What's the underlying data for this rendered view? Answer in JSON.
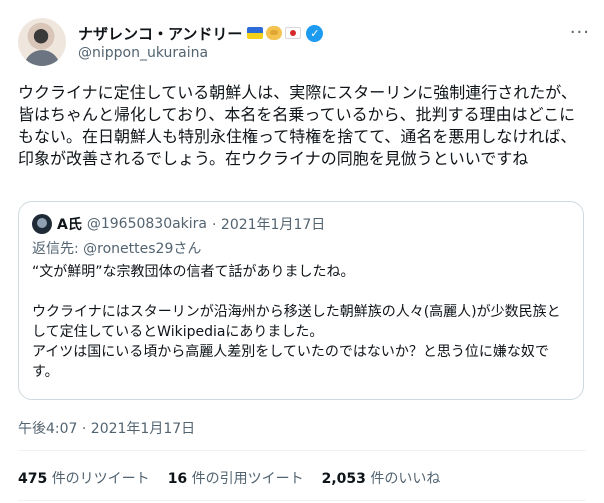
{
  "author": {
    "name": "ナザレンコ・アンドリー",
    "handle": "@nippon_ukuraina",
    "badges": [
      "ukraine-flag-icon",
      "handshake-icon",
      "japan-flag-icon",
      "verified-icon"
    ]
  },
  "more_label": "···",
  "tweet": {
    "text": "ウクライナに定住している朝鮮人は、実際にスターリンに強制連行されたが、皆はちゃんと帰化しており、本名を名乗っているから、批判する理由はどこにもない。在日朝鮮人も特別永住権って特権を捨てて、通名を悪用しなければ、印象が改善されるでしょう。在ウクライナの同胞を見倣うといいですね",
    "timestamp": "午後4:07 · 2021年1月17日"
  },
  "quote": {
    "name": "A氏",
    "handle": "@19650830akira",
    "date": "· 2021年1月17日",
    "reply_prefix": "返信先:",
    "reply_to": "@ronettes29さん",
    "line1": "“文が鮮明”な宗教団体の信者て話がありましたね。",
    "line2": "ウクライナにはスターリンが沿海州から移送した朝鮮族の人々(高麗人)が少数民族として定住しているとWikipediaにありました。",
    "line3": "アイツは国にいる頃から高麗人差別をしていたのではないか？と思う位に嫌な奴です。"
  },
  "stats": {
    "retweets_count": "475",
    "retweets_label": "件のリツイート",
    "quotes_count": "16",
    "quotes_label": "件の引用ツイート",
    "likes_count": "2,053",
    "likes_label": "件のいいね"
  },
  "colors": {
    "text": "#0f1419",
    "secondary": "#536471",
    "verified": "#1d9bf0",
    "border": "#cfd9de"
  }
}
